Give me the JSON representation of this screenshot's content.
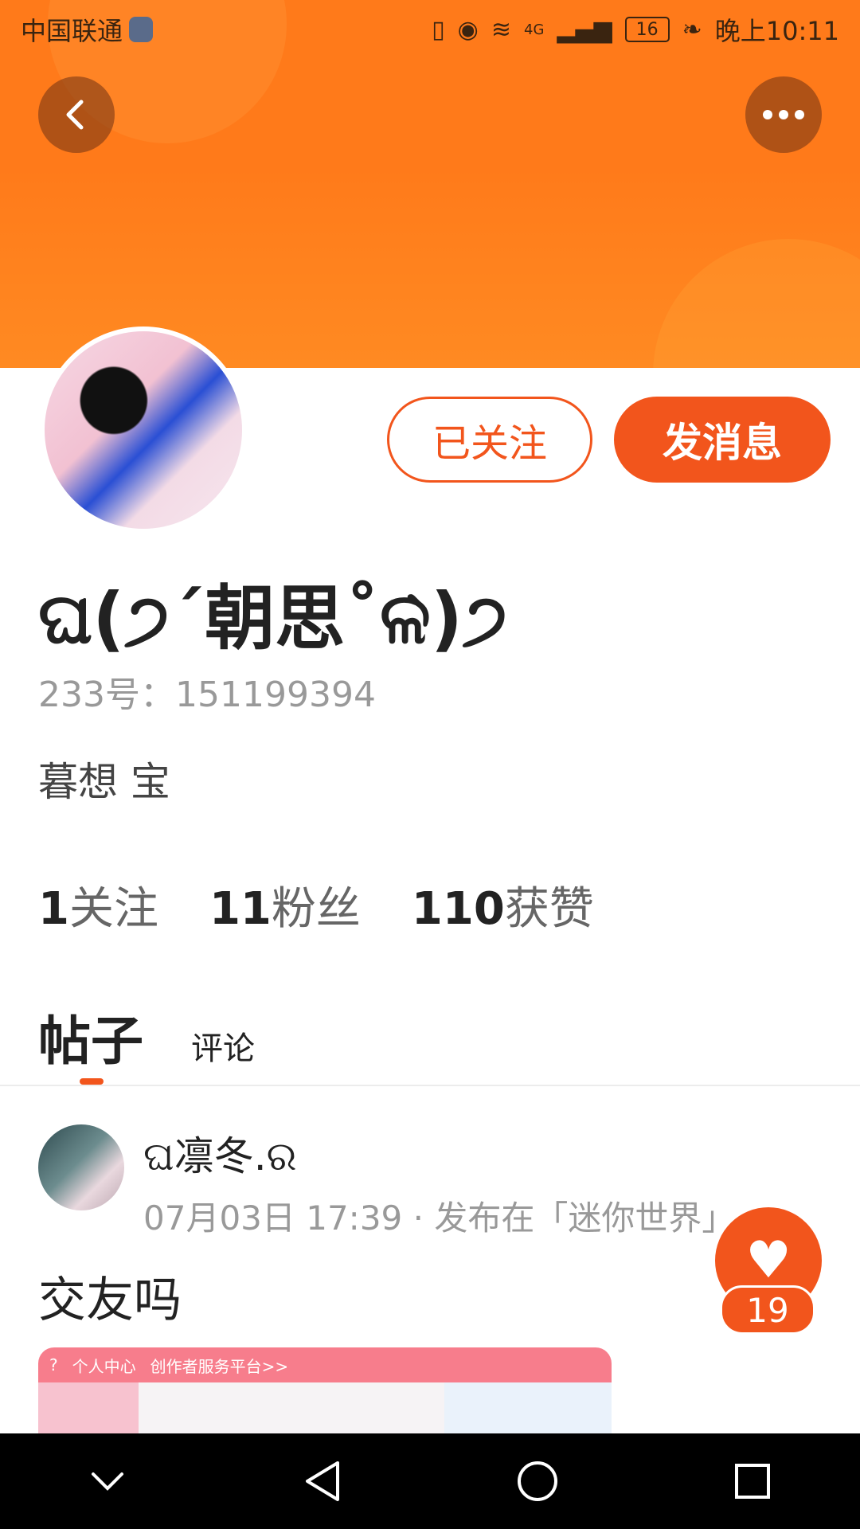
{
  "status_bar": {
    "carrier": "中国联通",
    "network": "4G",
    "battery": "16",
    "time": "晚上10:11"
  },
  "header": {
    "back_icon": "back-arrow-icon",
    "more_icon": "more-dots-icon"
  },
  "actions": {
    "follow_label": "已关注",
    "message_label": "发消息"
  },
  "profile": {
    "nickname": "ଘ(੭ˊ朝思˚ଳ̀)੭",
    "id_label": "233号：",
    "id_value": "151199394",
    "bio": "暮想 宝"
  },
  "stats": [
    {
      "value": "1",
      "label": "关注"
    },
    {
      "value": "11",
      "label": "粉丝"
    },
    {
      "value": "110",
      "label": "获赞"
    }
  ],
  "tabs": {
    "posts": "帖子",
    "comments": "评论"
  },
  "post": {
    "author": "ଘ凛冬.ର",
    "meta": "07月03日 17:39 · 发布在「迷你世界」",
    "text": "交友吗",
    "image_label": "个人中心",
    "image_sub": "创作者服务平台>>"
  },
  "like": {
    "count": "19"
  },
  "colors": {
    "accent": "#f2551c",
    "banner": "#ff7a1a"
  }
}
